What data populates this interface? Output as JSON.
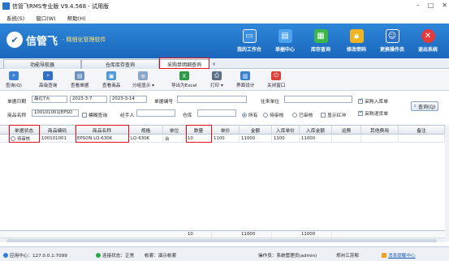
{
  "window": {
    "title": "信管飞RMS专业版 V9.4.568 - 试用版"
  },
  "menu": [
    {
      "label": "系统(S)"
    },
    {
      "label": "窗口(W)"
    },
    {
      "label": "帮助(H)"
    }
  ],
  "brand": {
    "name": "信管飞",
    "slogan": "· 精细化管理软件"
  },
  "topnav": [
    {
      "label": "我的工作台",
      "icon": "monitor-icon"
    },
    {
      "label": "单据中心",
      "icon": "documents-icon"
    },
    {
      "label": "库存查询",
      "icon": "inventory-icon"
    },
    {
      "label": "修改密码",
      "icon": "lock-icon"
    },
    {
      "label": "更换操作员",
      "icon": "users-icon"
    },
    {
      "label": "退出系统",
      "icon": "exit-icon"
    }
  ],
  "tabs": [
    {
      "label": "功能导航器"
    },
    {
      "label": "仓库库存查询"
    },
    {
      "label": "采购单明细查询",
      "active": true
    }
  ],
  "tab_close": "×",
  "toolbar": [
    {
      "label": "查询(Q)",
      "icon": "search-icon"
    },
    {
      "label": "高级查询",
      "icon": "advanced-search-icon"
    },
    {
      "label": "查看单据",
      "icon": "view-document-icon"
    },
    {
      "label": "查看商品",
      "icon": "view-product-icon"
    },
    {
      "label": "分组显示 ▾",
      "icon": "group-icon"
    },
    {
      "label": "导出为Excel",
      "icon": "excel-icon"
    },
    {
      "label": "打印 ▾",
      "icon": "print-icon"
    },
    {
      "label": "界面设计",
      "icon": "design-icon"
    },
    {
      "label": "关闭窗口",
      "icon": "close-window-icon"
    }
  ],
  "filters": {
    "date_label": "单据日期",
    "date_range": "最近7天",
    "date_from": "2023-3-7",
    "date_to": "2023-3-14",
    "doc_no_label": "单据编号",
    "doc_no_value": "",
    "partner_label": "往来单位",
    "partner_value": "",
    "product_label": "商品名称",
    "product_value": "100101001|EPSO",
    "fuzzy_label": "模糊查询",
    "handler_label": "经手人",
    "handler_value": "",
    "warehouse_label": "仓库",
    "warehouse_value": "",
    "status_all": "所有",
    "status_pending": "待审核",
    "status_approved": "已审核",
    "show_red_label": "显示红冲",
    "check_in": "采购入库单",
    "check_return": "采购退货单",
    "query_button": "查询(Q)"
  },
  "grid": {
    "columns": [
      "单据状态",
      "商品编码",
      "商品名称",
      "规格",
      "单位",
      "数量",
      "单价",
      "金额",
      "入库单价",
      "入库金额",
      "运费",
      "其他费用",
      "备注"
    ],
    "rows": [
      {
        "status": "待审核",
        "code": "100101001",
        "name": "EPSON LQ-630K",
        "spec": "LQ-630K",
        "unit": "台",
        "qty": "10",
        "price": "1100",
        "amount": "11000",
        "in_price": "1100",
        "in_amount": "11000",
        "freight": "",
        "other": "",
        "note": ""
      }
    ],
    "totals": {
      "qty": "10",
      "amount": "11000",
      "in_amount": "11000"
    }
  },
  "statusbar": {
    "app_center": "应用中心：127.0.0.1:7099",
    "connection": "连接状态：正常",
    "account": "帐套：演示帐套",
    "operator": "操作员：系统管理员(admin)",
    "branch": "郑州江苏郁",
    "messages": "消息提醒中心"
  },
  "colors": {
    "banner": "#1a66bb",
    "highlight": "#e0101a",
    "accent": "#1a5fb4"
  }
}
